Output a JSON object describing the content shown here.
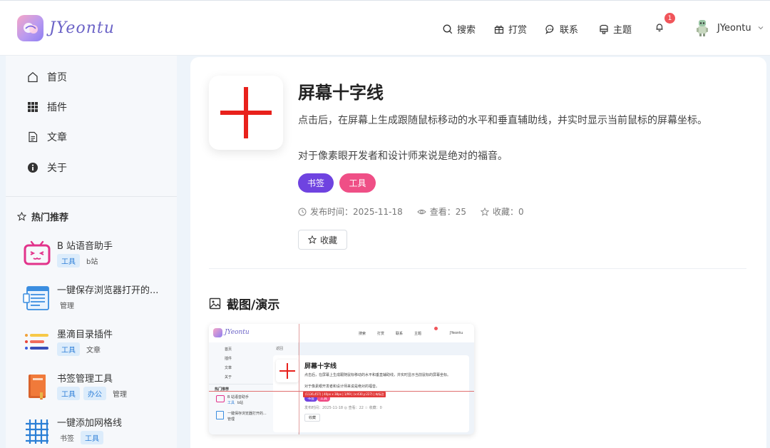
{
  "header": {
    "logo_text": "JYeontu",
    "nav": [
      {
        "label": "搜索",
        "icon": "search-icon"
      },
      {
        "label": "打赏",
        "icon": "gift-icon"
      },
      {
        "label": "联系",
        "icon": "chat-icon"
      },
      {
        "label": "主题",
        "icon": "theme-icon"
      }
    ],
    "notification_count": "1",
    "username": "JYeontu"
  },
  "sidebar": {
    "menu": [
      {
        "label": "首页",
        "icon": "home-icon"
      },
      {
        "label": "插件",
        "icon": "grid-icon"
      },
      {
        "label": "文章",
        "icon": "document-icon"
      },
      {
        "label": "关于",
        "icon": "info-icon"
      }
    ],
    "hot_title": "热门推荐",
    "hot_items": [
      {
        "name": "B 站语音助手",
        "tags": [
          "工具",
          "b站"
        ],
        "icon": "bilibili-tv-icon"
      },
      {
        "name": "一键保存浏览器打开的...",
        "tags": [
          "管理"
        ],
        "icon": "browser-save-icon"
      },
      {
        "name": "墨滴目录插件",
        "tags": [
          "工具",
          "文章"
        ],
        "icon": "toc-icon"
      },
      {
        "name": "书签管理工具",
        "tags": [
          "工具",
          "办公",
          "管理"
        ],
        "icon": "bookmark-book-icon"
      },
      {
        "name": "一键添加网格线",
        "tags": [
          "书签",
          "工具"
        ],
        "icon": "grid-lines-icon"
      }
    ]
  },
  "main": {
    "title": "屏幕十字线",
    "description": "点击后，在屏幕上生成跟随鼠标移动的水平和垂直辅助线，并实时显示当前鼠标的屏幕坐标。",
    "description2": "对于像素眼开发者和设计师来说是绝对的福音。",
    "tags": [
      "书签",
      "工具"
    ],
    "tag_colors": [
      "#6f43e0",
      "#ef4f86"
    ],
    "publish": "发布时间：2025-11-18",
    "views": "查看：25",
    "favorites": "收藏：0",
    "favorite_button": "收藏",
    "section_title": "截图/演示"
  },
  "thumb": {
    "logo_text": "JYeontu",
    "nav": [
      "搜索",
      "打赏",
      "联系",
      "主题"
    ],
    "username": "JYeontu",
    "back": "返回",
    "menu": [
      "首页",
      "插件",
      "文章",
      "关于"
    ],
    "hot_title": "热门推荐",
    "hot_items": [
      "B 站语音助手",
      "一键保存浏览器打开的..."
    ],
    "hot_tags": [
      "工具",
      "b站",
      "管理"
    ],
    "title": "屏幕十字线",
    "description": "点击后，在屏幕上生成跟随鼠标移动的水平和垂直辅助线，并实时显示当前鼠标的屏幕坐标。",
    "description2": "对于像素眼开发者和设计师来说是绝对的福音。",
    "coords": "(1136,457) | 40px x 38px | 1/99 | (x:430,y:227) | 有标注",
    "tags": [
      "书签",
      "工具"
    ],
    "meta": "发布时间：2025-11-18  ◎ 查看：22  ☆ 收藏：0",
    "favorite_button": "收藏"
  }
}
